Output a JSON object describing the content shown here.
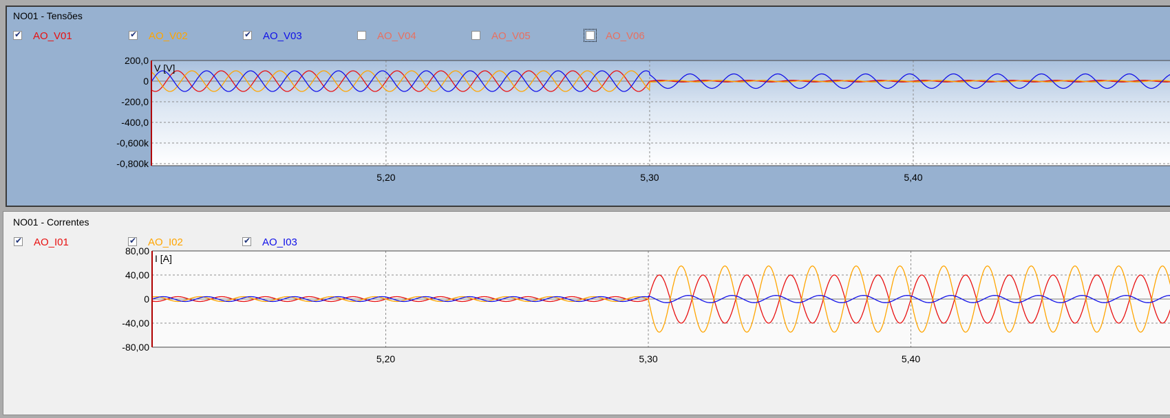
{
  "panels": [
    {
      "title": "NO01 - Tensões",
      "channels": [
        {
          "label": "AO_V01",
          "checked": true,
          "color": "#e81010"
        },
        {
          "label": "AO_V02",
          "checked": true,
          "color": "#ffa500"
        },
        {
          "label": "AO_V03",
          "checked": true,
          "color": "#1010e8"
        },
        {
          "label": "AO_V04",
          "checked": false,
          "color": "#e87060"
        },
        {
          "label": "AO_V05",
          "checked": false,
          "color": "#e87060"
        },
        {
          "label": "AO_V06",
          "checked": false,
          "color": "#e87060"
        }
      ]
    },
    {
      "title": "NO01 - Correntes",
      "channels": [
        {
          "label": "AO_I01",
          "checked": true,
          "color": "#e81010"
        },
        {
          "label": "AO_I02",
          "checked": true,
          "color": "#ffa500"
        },
        {
          "label": "AO_I03",
          "checked": true,
          "color": "#1010e8"
        }
      ]
    }
  ],
  "chart_data": [
    {
      "type": "line",
      "unit_label": "V [V]",
      "y_tick_labels": [
        "200,0",
        "0",
        "-200,0",
        "-400,0",
        "-0,600k",
        "-0,800k"
      ],
      "y_ticks": [
        200,
        0,
        -200,
        -400,
        -600,
        -800
      ],
      "ylim": [
        -820,
        200
      ],
      "x_tick_labels": [
        "5,20",
        "5,30",
        "5,40"
      ],
      "x_ticks": [
        5.2,
        5.3,
        5.4
      ],
      "xlim": [
        5.111,
        5.5
      ],
      "grid": true,
      "frequency_hz": 60,
      "event_time": 5.3,
      "series": [
        {
          "name": "AO_V01",
          "color": "#e81010",
          "amp_before": 100,
          "amp_after": 8,
          "phase_deg": 0
        },
        {
          "name": "AO_V02",
          "color": "#ffa500",
          "amp_before": 100,
          "amp_after": 8,
          "phase_deg": -120
        },
        {
          "name": "AO_V03",
          "color": "#1010e8",
          "amp_before": 100,
          "amp_after": 70,
          "phase_deg": 120
        }
      ]
    },
    {
      "type": "line",
      "unit_label": "I [A]",
      "y_tick_labels": [
        "80,00",
        "40,00",
        "0",
        "-40,00",
        "-80,00"
      ],
      "y_ticks": [
        80,
        40,
        0,
        -40,
        -80
      ],
      "ylim": [
        -80,
        80
      ],
      "x_tick_labels": [
        "5,20",
        "5,30",
        "5,40"
      ],
      "x_ticks": [
        5.2,
        5.3,
        5.4
      ],
      "xlim": [
        5.111,
        5.5
      ],
      "grid": true,
      "frequency_hz": 60,
      "event_time": 5.3,
      "series": [
        {
          "name": "AO_I01",
          "color": "#e81010",
          "amp_before": 4,
          "amp_after": 40,
          "phase_deg": 0
        },
        {
          "name": "AO_I02",
          "color": "#ffa500",
          "amp_before": 4,
          "amp_after": 55,
          "phase_deg": 180
        },
        {
          "name": "AO_I03",
          "color": "#1010e8",
          "amp_before": 4,
          "amp_after": 6,
          "phase_deg": 120
        }
      ]
    }
  ]
}
